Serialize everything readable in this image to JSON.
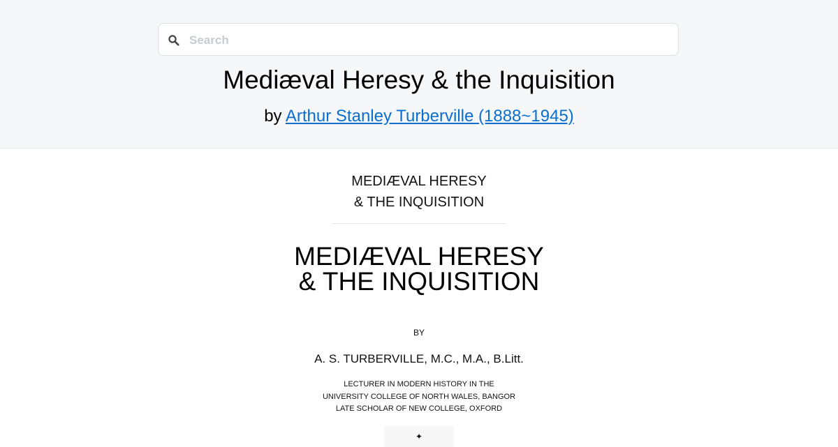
{
  "search": {
    "placeholder": "Search",
    "value": ""
  },
  "header": {
    "title": "Mediæval Heresy & the Inquisition",
    "by_prefix": "by",
    "author_link": "Arthur Stanley Turberville (1888~1945)"
  },
  "document": {
    "half_title_line1": "MEDIÆVAL HERESY",
    "half_title_line2": "& THE INQUISITION",
    "title_line1": "MEDIÆVAL HERESY",
    "title_line2": "& THE INQUISITION",
    "by_label": "BY",
    "author": "A. S. TURBERVILLE, M.C., M.A., B.Litt.",
    "credentials": [
      "LECTURER IN MODERN HISTORY IN THE",
      "UNIVERSITY COLLEGE OF NORTH WALES, BANGOR",
      "LATE SCHOLAR OF NEW COLLEGE, OXFORD"
    ]
  },
  "colors": {
    "link": "#0a6ed1",
    "header_bg": "#f6f7f9"
  },
  "icons": {
    "search": "search-icon"
  }
}
